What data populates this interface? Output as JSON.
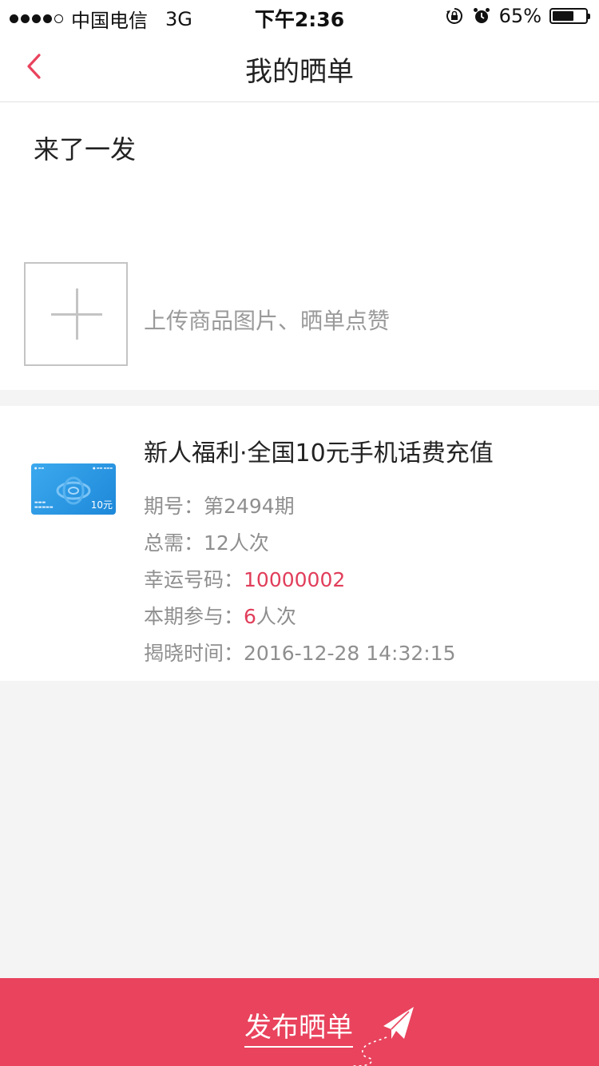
{
  "status_bar": {
    "carrier": "中国电信",
    "network": "3G",
    "time": "下午2:36",
    "battery_percent": "65%",
    "battery_level": 0.65
  },
  "nav": {
    "title": "我的晒单",
    "back_icon": "chevron-left-icon",
    "back_color": "#e9435d"
  },
  "post": {
    "text": "来了一发",
    "upload_hint": "上传商品图片、晒单点赞",
    "upload_icon": "plus-icon"
  },
  "product": {
    "title": "新人福利·全国10元手机话费充值",
    "thumb": {
      "price": "10元"
    },
    "period_label": "期号：",
    "period_value": "第2494期",
    "total_label": "总需：",
    "total_value": "12人次",
    "lucky_label": "幸运号码：",
    "lucky_value": "10000002",
    "joined_label": "本期参与：",
    "joined_count": "6",
    "joined_unit": "人次",
    "reveal_label": "揭晓时间：",
    "reveal_value": "2016-12-28 14:32:15"
  },
  "footer": {
    "publish_label": "发布晒单",
    "publish_icon": "paper-plane-icon",
    "accent_color": "#e9435d"
  }
}
